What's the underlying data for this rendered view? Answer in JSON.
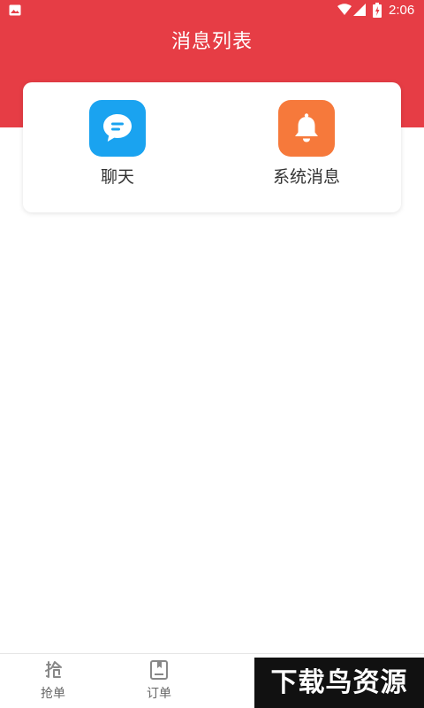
{
  "status_bar": {
    "time": "2:06",
    "icons": [
      "gallery-icon",
      "wifi-icon",
      "cellular-signal-icon",
      "battery-charging-icon"
    ]
  },
  "header": {
    "title": "消息列表",
    "background_color": "#e63d45"
  },
  "entries": [
    {
      "label": "聊天",
      "icon": "chat-bubble-icon",
      "color": "#1aa3f0"
    },
    {
      "label": "系统消息",
      "icon": "bell-icon",
      "color": "#f6793b"
    }
  ],
  "tab_bar": {
    "tabs": [
      {
        "label": "抢单",
        "icon": "grab-order-icon"
      },
      {
        "label": "订单",
        "icon": "order-book-icon"
      },
      {
        "label": "",
        "icon": "message-icon"
      },
      {
        "label": "",
        "icon": "profile-icon"
      }
    ]
  },
  "watermark": {
    "text": "下载鸟资源"
  }
}
